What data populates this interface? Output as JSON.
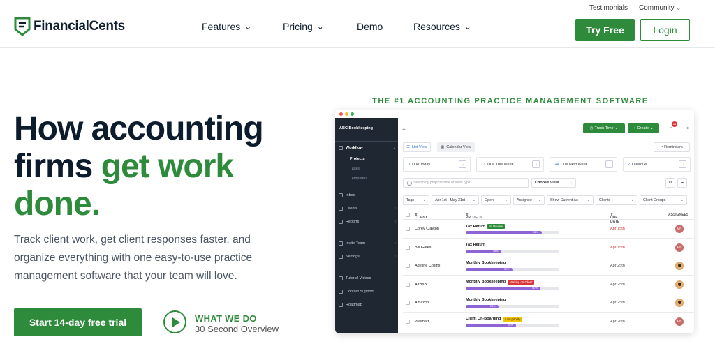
{
  "header": {
    "top_links": [
      "Testimonials",
      "Community"
    ],
    "brand": "FinancialCents",
    "nav": [
      {
        "label": "Features",
        "has_dropdown": true
      },
      {
        "label": "Pricing",
        "has_dropdown": true
      },
      {
        "label": "Demo",
        "has_dropdown": false
      },
      {
        "label": "Resources",
        "has_dropdown": true
      }
    ],
    "try_free": "Try Free",
    "login": "Login"
  },
  "hero": {
    "title_part1": "How accounting firms ",
    "title_part2": "get work done.",
    "subtitle": "Track client work, get client responses faster, and organize everything with one easy-to-use practice management software that your team will love.",
    "cta": "Start 14-day free trial",
    "video_title": "WHAT WE DO",
    "video_sub": "30 Second Overview",
    "tagline": "THE #1 ACCOUNTING PRACTICE MANAGEMENT SOFTWARE"
  },
  "app": {
    "company": "ABC Bookkeeping",
    "sidebar": {
      "workflow": "Workflow",
      "sub": [
        "Projects",
        "Tasks",
        "Templates"
      ],
      "items": [
        "Inbox",
        "Clients",
        "Reports",
        "Invite Team",
        "Settings",
        "Tutorial Videos",
        "Contact Support",
        "Roadmap"
      ]
    },
    "track_time": "Track Time",
    "create": "Create",
    "notification_count": "11",
    "views": [
      "List View",
      "Calendar View"
    ],
    "reminders": "Reminders",
    "stats": [
      {
        "num": "0",
        "label": "Due Today"
      },
      {
        "num": "13",
        "label": "Due This Week"
      },
      {
        "num": "24",
        "label": "Due Next Week"
      },
      {
        "num": "2",
        "label": "Overdue"
      }
    ],
    "search_placeholder": "Search by project name or work type",
    "choose_view": "Choose View",
    "filters": [
      "Tags",
      "Apr 1st - May 31st",
      "Open",
      "Assignee",
      "Show Current As",
      "Clients",
      "Client Groups"
    ],
    "columns": [
      "CLIENT",
      "PROJECT",
      "DUE DATE",
      "ASSIGNEES"
    ],
    "rows": [
      {
        "client": "Corey Clayton",
        "project": "Tax Return",
        "tag": "In Review",
        "tag_color": "#2e8b3b",
        "progress": 0.81,
        "pct": "81%",
        "due": "Apr 15th",
        "due_color": "#d64040",
        "avatar": "MR",
        "avatar_type": "initials"
      },
      {
        "client": "Bill Gates",
        "project": "Tax Return",
        "tag": "",
        "tag_color": "",
        "progress": 0.38,
        "pct": "38%",
        "due": "Apr 15th",
        "due_color": "#d64040",
        "avatar": "MR",
        "avatar_type": "initials"
      },
      {
        "client": "Adeline Collins",
        "project": "Monthly Bookkeeping",
        "tag": "",
        "tag_color": "",
        "progress": 0.5,
        "pct": "50%",
        "due": "Apr 25th",
        "due_color": "#555555",
        "avatar": "",
        "avatar_type": "photo"
      },
      {
        "client": "AirBnB",
        "project": "Monthly Bookkeeping",
        "tag": "Waiting on Client",
        "tag_color": "#d93838",
        "progress": 0.8,
        "pct": "80%",
        "due": "Apr 25th",
        "due_color": "#555555",
        "avatar": "",
        "avatar_type": "photo"
      },
      {
        "client": "Amazon",
        "project": "Monthly Bookkeeping",
        "tag": "",
        "tag_color": "",
        "progress": 0.35,
        "pct": "35%",
        "due": "Apr 25th",
        "due_color": "#555555",
        "avatar": "",
        "avatar_type": "photo"
      },
      {
        "client": "Walmart",
        "project": "Client On-Boarding",
        "tag": "Low priority",
        "tag_color": "#f2c200",
        "progress": 0.54,
        "pct": "54%",
        "due": "Apr 26th",
        "due_color": "#555555",
        "avatar": "MR",
        "avatar_type": "initials"
      }
    ]
  },
  "colors": {
    "brand_green": "#2e8b3b",
    "dark_navy": "#0c1c2c",
    "progress_purple": "#8e63d6",
    "sidebar": "#1f2733"
  }
}
